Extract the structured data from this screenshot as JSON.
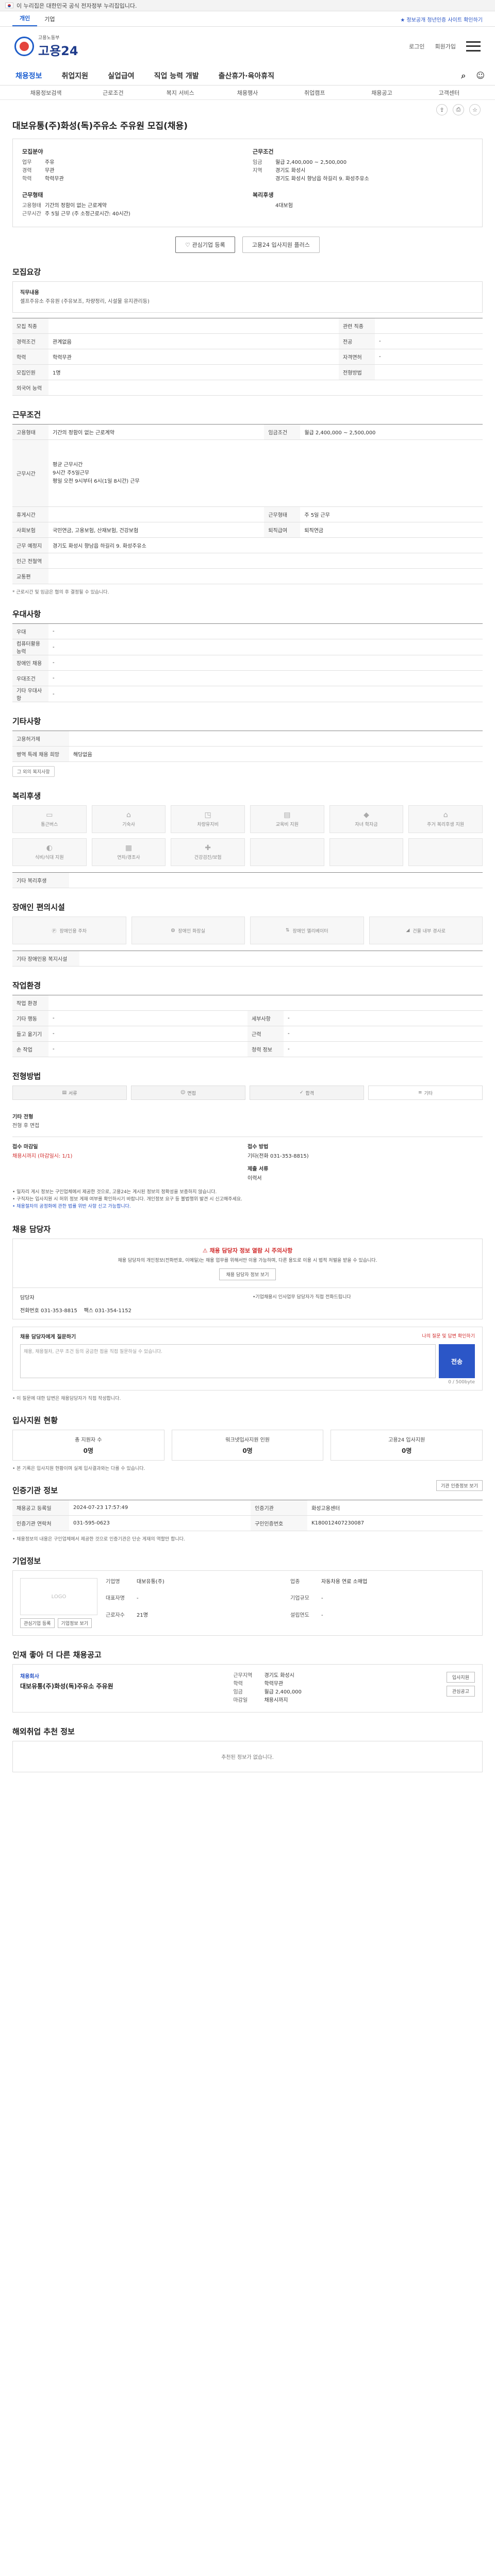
{
  "gov": {
    "text": "이 누리집은 대한민국 공식 전자정부 누리집입니다."
  },
  "top_tabs": [
    "개인",
    "기업"
  ],
  "top_links": "★ 정보공개 청년인증 사이트 확인하기",
  "logo": {
    "sub": "고용노동부",
    "main": "고용24"
  },
  "header_right": {
    "login": "로그인",
    "join": "회원가입"
  },
  "gnb": [
    "채용정보",
    "취업지원",
    "실업급여",
    "직업 능력 개발",
    "출산휴가·육아휴직"
  ],
  "sub_gnb": [
    "채용정보검색",
    "근로조건",
    "복지 서비스",
    "채용행사",
    "취업캠프",
    "채용공고",
    "고객센터"
  ],
  "job": {
    "title": "대보유통(주)화성(독)주유소 주유원 모집(채용)"
  },
  "summary": {
    "left_h1": "모집분야",
    "rows1": [
      {
        "k": "업무",
        "v": "주유"
      },
      {
        "k": "경력",
        "v": "무관"
      },
      {
        "k": "학력",
        "v": "학력무관"
      }
    ],
    "left_h2": "근무형태",
    "rows2": [
      {
        "k": "고용형태",
        "v": "기간의 정함이 없는 근로계약"
      },
      {
        "k": "근무시간",
        "v": "주 5일 근무 (주 소정근로시간: 40시간)"
      }
    ],
    "right_h1": "근무조건",
    "rows3": [
      {
        "k": "임금",
        "v": "월급 2,400,000 ~ 2,500,000"
      },
      {
        "k": "지역",
        "v": "경기도 화성시"
      },
      {
        "k": "",
        "v": "경기도 화성시 향남읍 하길리 9. 화성주유소"
      }
    ],
    "right_h2": "복리후생",
    "rows4": [
      {
        "k": "",
        "v": "4대보험"
      }
    ]
  },
  "buttons": {
    "interest": "관심기업 등록",
    "share": "고용24 입사지원 플러스"
  },
  "sections": {
    "recruit": "모집요강",
    "work": "근무조건",
    "qualify": "우대사항",
    "other": "기타사항",
    "welfare": "복리후생",
    "disabled": "장애인 편의시설",
    "env": "작업환경",
    "process": "전형방법",
    "manager": "채용 담당자",
    "status": "입사지원 현황",
    "info": "인증기관 정보",
    "company": "기업정보",
    "similar": "인재 좋아 더 다른 채용공고",
    "recommend": "해외취업 추천 정보"
  },
  "recruit": {
    "duty_h": "직무내용",
    "duty": "셀프주유소 주유원 (주유보조, 차량정리, 시설물 유지관리등)",
    "rows": [
      {
        "k1": "모집 직종",
        "v1": "",
        "k2": "관련 직종",
        "v2": ""
      },
      {
        "k1": "경력조건",
        "v1": "관계없음",
        "k2": "전공",
        "v2": "-"
      },
      {
        "k1": "학력",
        "v1": "학력무관",
        "k2": "자격면허",
        "v2": "-"
      },
      {
        "k1": "모집인원",
        "v1": "1명",
        "k2": "전형방법",
        "v2": ""
      },
      {
        "k1": "외국어 능력",
        "v1": "",
        "k2": "",
        "v2": ""
      }
    ]
  },
  "work": {
    "rows": [
      {
        "k1": "고용형태",
        "v1": "기간의 정함이 없는 근로계약",
        "k2": "임금조건",
        "v2": "월급 2,400,000 ~ 2,500,000"
      },
      {
        "k1": "근무시간",
        "v1": "주 소정근로시간: 40시간",
        "k2": "",
        "v2": ""
      },
      {
        "k1": "휴게시간",
        "v1": "",
        "k2": "근무형태",
        "v2": "주 5일 근무"
      },
      {
        "k1": "사회보험",
        "v1": "국민연금, 고용보험, 산재보험, 건강보험",
        "k2": "퇴직급여",
        "v2": "퇴직연금"
      },
      {
        "k1": "근무 예정지",
        "v1": "경기도 화성시 향남읍 하길리 9. 화성주유소",
        "k2": "",
        "v2": ""
      },
      {
        "k1": "인근 전철역",
        "v1": "",
        "k2": "",
        "v2": ""
      },
      {
        "k1": "교통편",
        "v1": "",
        "k2": "",
        "v2": ""
      }
    ],
    "work_hours_detail": "평균 근무시간\n9시간 주5일근무\n평일 오전 9시부터 6시(1일 8시간) 근무",
    "note": "* 근로시간 및 임금은 협의 후 결정될 수 있습니다."
  },
  "qualify": {
    "rows": [
      {
        "k": "우대",
        "v": "-"
      },
      {
        "k": "컴퓨터활용 능력",
        "v": "-"
      },
      {
        "k": "장애인 채용",
        "v": "-"
      },
      {
        "k": "우대조건",
        "v": "-"
      },
      {
        "k": "기타 우대사항",
        "v": "-"
      }
    ]
  },
  "other": {
    "rows": [
      {
        "k": "고용허가제",
        "v": ""
      },
      {
        "k": "병역 특례 채용 희망",
        "v": "해당없음"
      }
    ],
    "chip": "그 외의 복지사항"
  },
  "welfare_items": [
    "통근버스",
    "기숙사",
    "차량유지비",
    "교육비 지원",
    "자녀 학자금",
    "주거 복리후생 지원",
    "식비/식대 지원",
    "연차/경조사",
    "건강검진/보험",
    "",
    "",
    ""
  ],
  "welfare_note": "기타 복리후생",
  "disabled_items": [
    "장애인용 주차",
    "장애인 화장실",
    "장애인 엘리베이터",
    "건물 내부 경사로"
  ],
  "disabled_note": "기타 장애인용 복지시설",
  "env": {
    "rows": [
      {
        "k1": "작업 환경",
        "v1": "",
        "k2": "",
        "v2": ""
      },
      {
        "k1": "기타 행동",
        "v1": "-",
        "k2": "세부사항",
        "v2": "-"
      },
      {
        "k1": "들고 옮기기",
        "v1": "-",
        "k2": "근력",
        "v2": "-"
      },
      {
        "k1": "손 작업",
        "v1": "-",
        "k2": "청력 정보",
        "v2": "-"
      }
    ]
  },
  "process": {
    "steps": [
      "서류",
      "면접",
      "합격",
      "기타"
    ],
    "h1": "기타 전형",
    "v1": "전형 후 면접",
    "apply_h1": "접수 마감일",
    "apply_v1": "채용시까지 (마감일시: 1/1)",
    "apply_h2": "접수 방법",
    "apply_v2": "기타(전화 031-353-8815)",
    "apply_h3": "제출 서류",
    "apply_v3": "이력서",
    "warn1": "• 일자리 게시 정보는 구인업체에서 제공한 것으로, 고용24는 게시된 정보의 정확성을 보증하지 않습니다.",
    "warn2": "• 구직자는 입사지원 시 허위 정보 게재 여부를 확인하시기 바랍니다. 개인정보 요구 등 불법행위 발견 시 신고해주세요.",
    "warn3": "• 채용절차의 공정화에 관한 법률 위반 사항 신고 가능합니다."
  },
  "manager": {
    "alert_title": "채용 담당자 정보 열람 시 주의사항",
    "alert_text": "채용 담당자의 개인정보(전화번호, 이메일)는 채용 업무를 위해서만 이용 가능하며, 다른 용도로 이용 시 법적 처벌을 받을 수 있습니다.",
    "alert_btn": "채용 담당자 정보 보기",
    "name_k": "담당자",
    "name_v": "담당자",
    "phone_k": "전화번호",
    "phone_v": "031-353-8815",
    "fax_k": "팩스",
    "fax_v": "031-354-1152",
    "right_note": "•기업채용시 인사업무 담당자가 직접 전화드립니다",
    "inq_h": "채용 담당자에게 질문하기",
    "inq_link": "나의 질문 및 답변 확인하기",
    "inq_placeholder": "채용, 채용절차, 근무 조건 등의 궁금한 점을 직접 질문하실 수 있습니다.",
    "inq_btn": "전송",
    "inq_count": "0 / 500byte",
    "inq_note": "• 이 질문에 대한 답변은 채용담당자가 직접 작성합니다."
  },
  "status": [
    {
      "label": "총 지원자 수",
      "value": "0명"
    },
    {
      "label": "워크넷입사지원 인원",
      "value": "0명"
    },
    {
      "label": "고용24 입사지원",
      "value": "0명"
    }
  ],
  "status_note": "• 본 기록은 입사지원 현황이며 실제 입사결과와는 다를 수 있습니다.",
  "info": {
    "btn": "기관 인증정보 보기",
    "rows": [
      {
        "k1": "채용공고 등록일",
        "v1": "2024-07-23 17:57:49",
        "k2": "인증기관",
        "v2": "화성고용센터"
      },
      {
        "k1": "인증기관 연락처",
        "v1": "031-595-0623",
        "k2": "구인인증번호",
        "v2": "K180012407230087"
      }
    ],
    "note": "• 채용정보의 내용은 구인업체에서 제공한 것으로 인증기관은 단순 게재의 역할만 합니다."
  },
  "company": {
    "logo": "LOGO",
    "rows": [
      {
        "k": "기업명",
        "v": "대보유통(주)"
      },
      {
        "k": "업종",
        "v": "자동차용 연료 소매업"
      },
      {
        "k": "대표자명",
        "v": "-"
      },
      {
        "k": "기업규모",
        "v": "-"
      },
      {
        "k": "근로자수",
        "v": "21명"
      },
      {
        "k": "설립연도",
        "v": "-"
      }
    ],
    "btn1": "관심기업 등록",
    "btn2": "기업정보 보기"
  },
  "similar": {
    "company": "채용회사",
    "title": "대보유통(주)화성(독)주유소 주유원",
    "rows": [
      {
        "k": "근무지역",
        "v": "경기도 화성시"
      },
      {
        "k": "학력",
        "v": "학력무관"
      },
      {
        "k": "임금",
        "v": "월급 2,400,000"
      },
      {
        "k": "마감일",
        "v": "채용시까지"
      }
    ],
    "btn1": "입사지원",
    "btn2": "관심공고"
  },
  "recommend": {
    "empty": "추천된 정보가 없습니다."
  }
}
